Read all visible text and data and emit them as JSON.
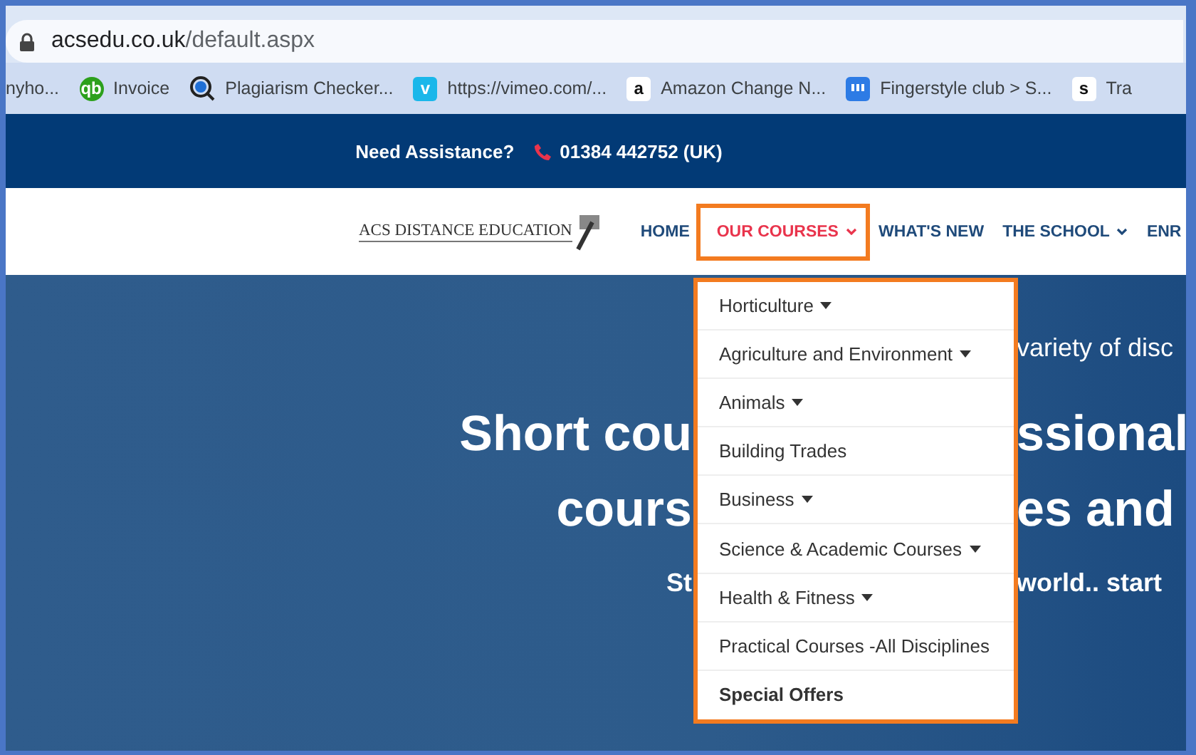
{
  "browser": {
    "address": {
      "host": "acsedu.co.uk",
      "path": "/default.aspx"
    },
    "bookmarks": [
      {
        "label": "nyho...",
        "kind": "none"
      },
      {
        "label": "Invoice",
        "kind": "round",
        "badge": "qb",
        "color": "#2ca01c"
      },
      {
        "label": "Plagiarism Checker...",
        "kind": "lens",
        "color": "#1f6fd6"
      },
      {
        "label": "https://vimeo.com/...",
        "kind": "tile",
        "badge": "v",
        "color": "#1ab7ea"
      },
      {
        "label": "Amazon Change N...",
        "kind": "tile",
        "badge": "a",
        "color": "#ffffff"
      },
      {
        "label": "Fingerstyle club > S...",
        "kind": "bars",
        "color": "#2d7be5"
      },
      {
        "label": "Tra",
        "kind": "tile",
        "badge": "s",
        "color": "#ffffff"
      }
    ]
  },
  "top_bar": {
    "label": "Need Assistance?",
    "phone": "01384 442752 (UK)"
  },
  "nav": {
    "logo": "ACS DISTANCE EDUCATION",
    "items": [
      {
        "label": "HOME",
        "selected": false,
        "dropdown": false
      },
      {
        "label": "OUR COURSES",
        "selected": true,
        "dropdown": true
      },
      {
        "label": "WHAT'S NEW",
        "selected": false,
        "dropdown": false
      },
      {
        "label": "THE SCHOOL",
        "selected": false,
        "dropdown": true
      },
      {
        "label": "ENR",
        "selected": false
      }
    ]
  },
  "dropdown": [
    {
      "label": "Horticulture",
      "submenu": true,
      "featured": false
    },
    {
      "label": "Agriculture and Environment",
      "submenu": true,
      "featured": false
    },
    {
      "label": "Animals",
      "submenu": true,
      "featured": false
    },
    {
      "label": "Building Trades",
      "submenu": false,
      "featured": false
    },
    {
      "label": "Business",
      "submenu": true,
      "featured": false
    },
    {
      "label": "Science & Academic Courses",
      "submenu": true,
      "featured": false
    },
    {
      "label": "Health & Fitness",
      "submenu": true,
      "featured": false
    },
    {
      "label": "Practical Courses -All Disciplines",
      "submenu": false,
      "featured": false
    },
    {
      "label": "Special Offers",
      "submenu": false,
      "featured": true
    }
  ],
  "hero": {
    "lines": [
      {
        "kind": "tagline",
        "right": "variety of disc"
      },
      {
        "kind": "headline",
        "left": "Short cou",
        "right": "ssional"
      },
      {
        "kind": "headline",
        "left": "cours",
        "right": "es and"
      },
      {
        "kind": "subline",
        "left": "St",
        "right": "world.. start"
      }
    ]
  }
}
